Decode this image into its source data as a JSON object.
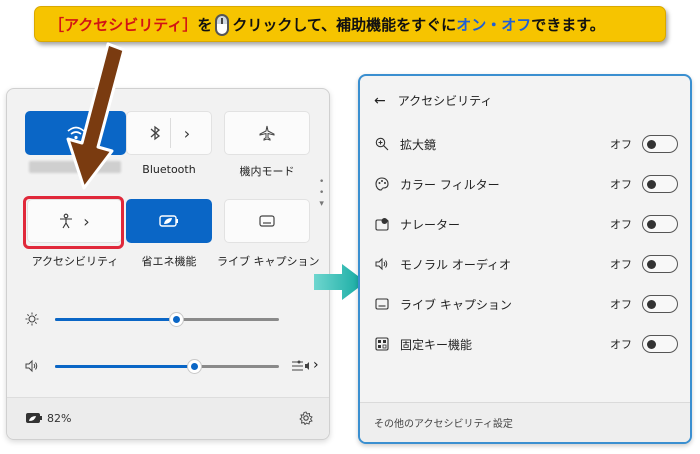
{
  "banner": {
    "part1": "［アクセシビリティ］",
    "part2": "を",
    "part3": "クリックして、補助機能をすぐに",
    "part4": "オン・オフ",
    "part5": "できます。"
  },
  "quick_settings": {
    "tiles": [
      {
        "label": "",
        "icon": "wifi-icon",
        "active": true
      },
      {
        "label": "Bluetooth",
        "icon": "bluetooth-icon",
        "active": false
      },
      {
        "label": "機内モード",
        "icon": "airplane-icon",
        "active": false
      },
      {
        "label": "アクセシビリティ",
        "icon": "accessibility-icon",
        "active": false
      },
      {
        "label": "省エネ機能",
        "icon": "battery-saver-icon",
        "active": true
      },
      {
        "label": "ライブ キャプション",
        "icon": "live-caption-icon",
        "active": false
      }
    ],
    "brightness": 0.54,
    "volume": 0.62,
    "battery": "82%"
  },
  "accessibility_panel": {
    "title": "アクセシビリティ",
    "items": [
      {
        "label": "拡大鏡",
        "state": "オフ",
        "icon": "magnifier-icon"
      },
      {
        "label": "カラー フィルター",
        "state": "オフ",
        "icon": "color-filter-icon"
      },
      {
        "label": "ナレーター",
        "state": "オフ",
        "icon": "narrator-icon"
      },
      {
        "label": "モノラル オーディオ",
        "state": "オフ",
        "icon": "mono-audio-icon"
      },
      {
        "label": "ライブ キャプション",
        "state": "オフ",
        "icon": "live-caption-icon"
      },
      {
        "label": "固定キー機能",
        "state": "オフ",
        "icon": "sticky-keys-icon"
      }
    ],
    "footer": "その他のアクセシビリティ設定"
  },
  "colors": {
    "accent_blue": "#0a66c6",
    "banner_yellow": "#f6c400",
    "highlight_red": "#e0283a",
    "arrow_brown": "#7a3b10",
    "arrow_teal": "#19b0a8"
  }
}
